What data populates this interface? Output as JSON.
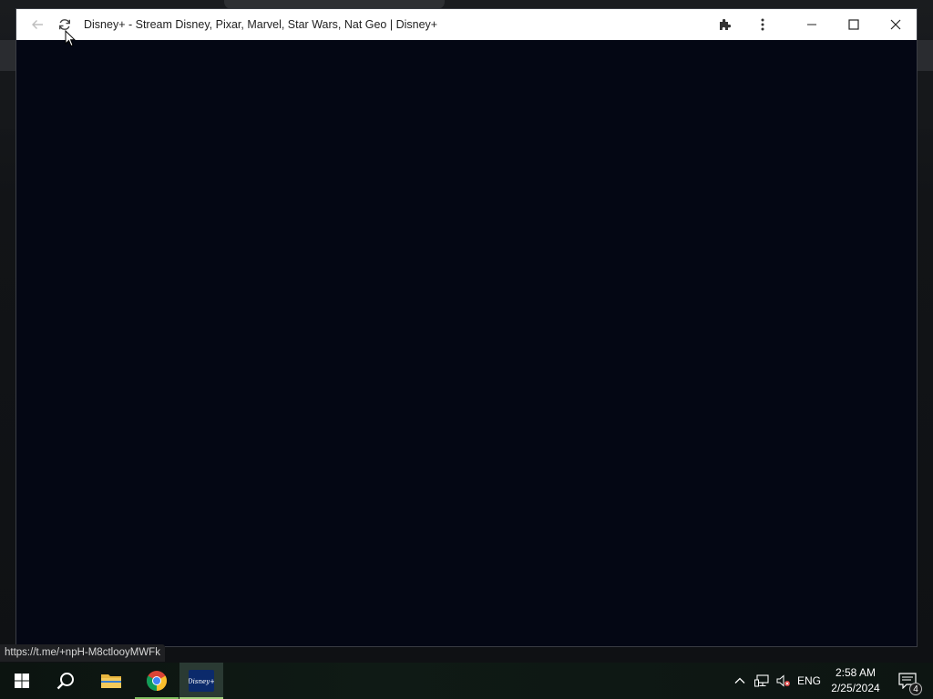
{
  "window": {
    "title": "Disney+ - Stream Disney, Pixar, Marvel, Star Wars, Nat Geo | Disney+"
  },
  "status_bar": {
    "url": "https://t.me/+npH-M8ctlooyMWFk"
  },
  "taskbar": {
    "items": [
      "start",
      "search",
      "file-explorer",
      "chrome",
      "disney-plus"
    ],
    "language": "ENG",
    "time": "2:58 AM",
    "date": "2/25/2024",
    "notification_count": "4"
  },
  "colors": {
    "page_background": "#040714",
    "titlebar": "#ffffff",
    "taskbar": "#0f1a15"
  }
}
